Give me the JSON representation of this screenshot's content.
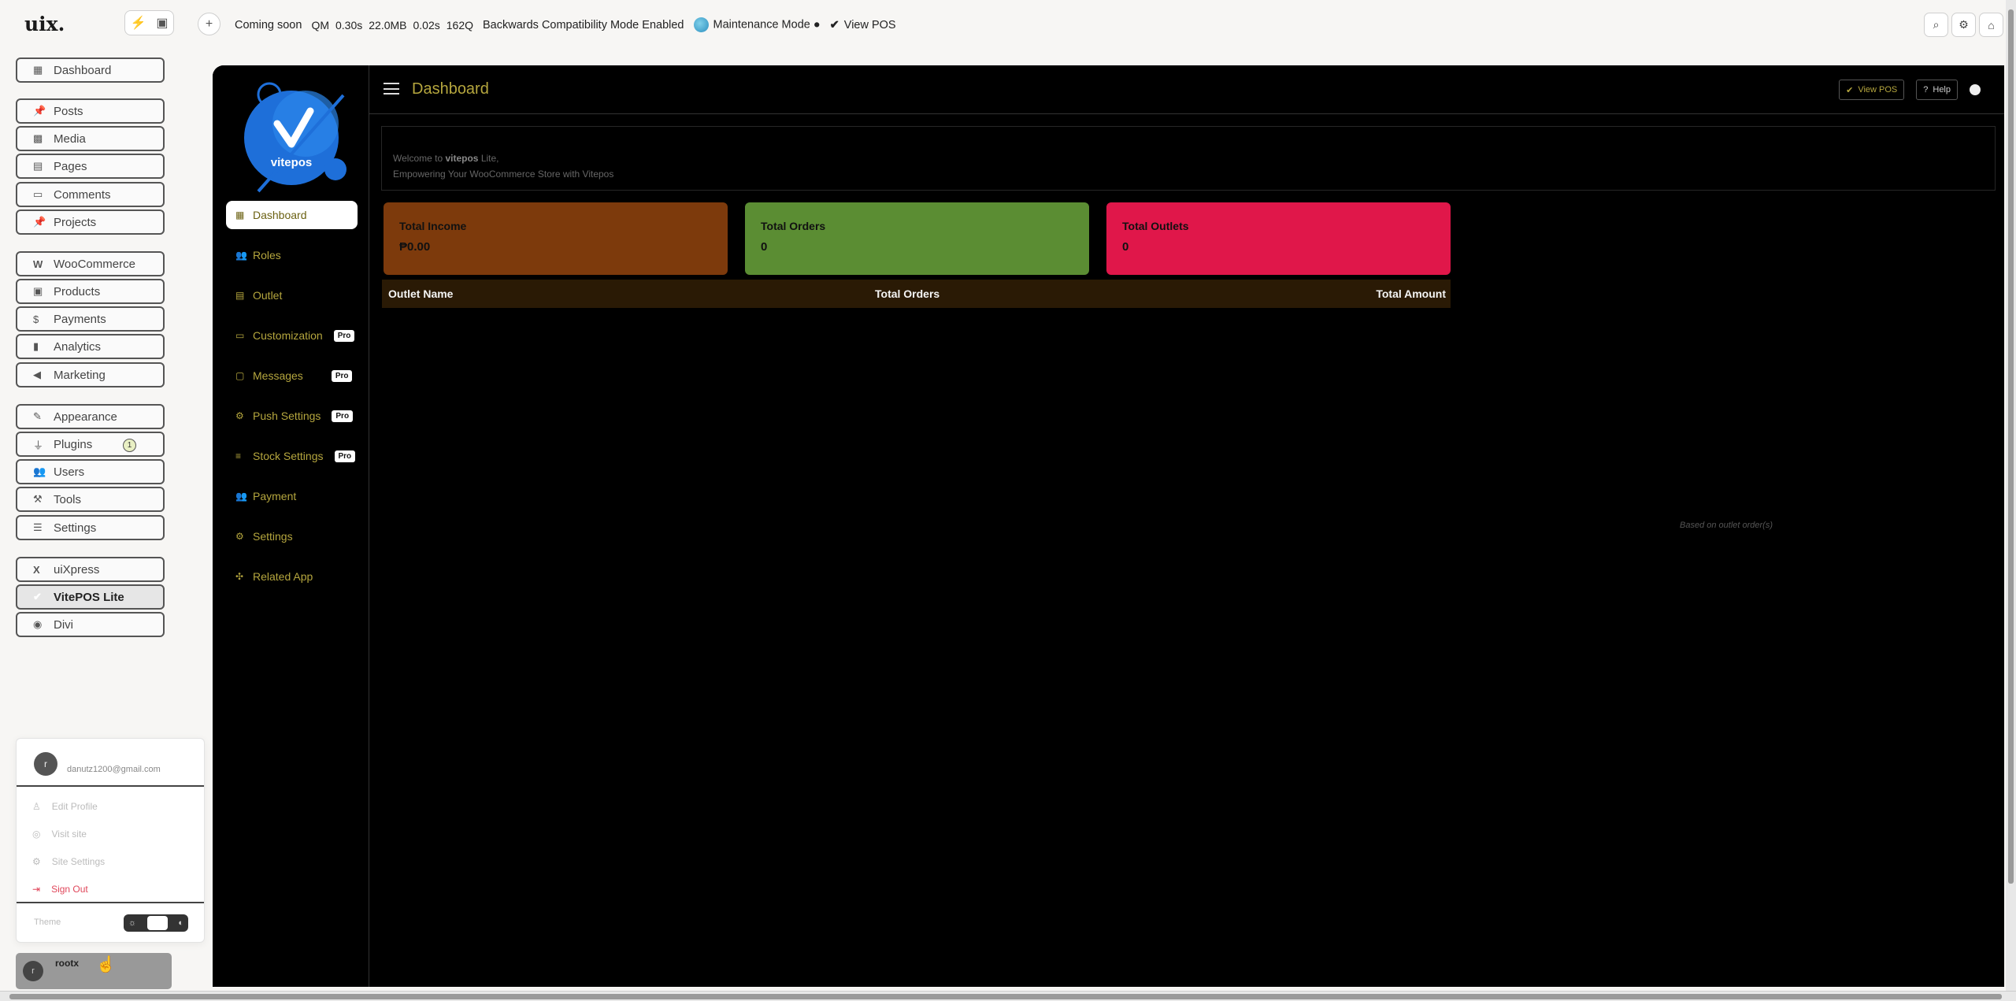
{
  "topbar": {
    "logo": "uix.",
    "items": [
      "Coming soon",
      "QM",
      "0.30s",
      "22.0MB",
      "0.02s",
      "162Q",
      "Backwards Compatibility Mode Enabled",
      "Maintenance Mode ●",
      "View POS"
    ]
  },
  "wp_menu": [
    {
      "label": "Dashboard",
      "icon": "grid-icon"
    },
    {
      "label": "Posts",
      "icon": "pin-icon"
    },
    {
      "label": "Media",
      "icon": "media-icon"
    },
    {
      "label": "Pages",
      "icon": "page-icon"
    },
    {
      "label": "Comments",
      "icon": "comment-icon"
    },
    {
      "label": "Projects",
      "icon": "pin-icon"
    },
    {
      "label": "WooCommerce",
      "icon": "woo-icon"
    },
    {
      "label": "Products",
      "icon": "box-icon"
    },
    {
      "label": "Payments",
      "icon": "dollar-icon"
    },
    {
      "label": "Analytics",
      "icon": "chart-icon"
    },
    {
      "label": "Marketing",
      "icon": "megaphone-icon"
    },
    {
      "label": "Appearance",
      "icon": "brush-icon"
    },
    {
      "label": "Plugins",
      "icon": "plug-icon",
      "badge": "1"
    },
    {
      "label": "Users",
      "icon": "users-icon"
    },
    {
      "label": "Tools",
      "icon": "wrench-icon"
    },
    {
      "label": "Settings",
      "icon": "sliders-icon"
    },
    {
      "label": "uiXpress",
      "icon": "x-icon"
    },
    {
      "label": "VitePOS Lite",
      "icon": "check-icon"
    },
    {
      "label": "Divi",
      "icon": "divi-icon"
    }
  ],
  "user_popup": {
    "avatar_letter": "r",
    "email": "danutz1200@gmail.com",
    "items": [
      "Edit Profile",
      "Visit site",
      "Site Settings",
      "Sign Out"
    ],
    "theme_label": "Theme"
  },
  "user_bar": {
    "avatar_letter": "r",
    "name": "rootx"
  },
  "vitepos": {
    "logo_text": "vitepos",
    "title": "Dashboard",
    "nav": [
      {
        "label": "Dashboard",
        "pro": false
      },
      {
        "label": "Roles",
        "pro": false
      },
      {
        "label": "Outlet",
        "pro": false
      },
      {
        "label": "Customization",
        "pro": true
      },
      {
        "label": "Messages",
        "pro": true
      },
      {
        "label": "Push Settings",
        "pro": true
      },
      {
        "label": "Stock Settings",
        "pro": true
      },
      {
        "label": "Payment",
        "pro": false
      },
      {
        "label": "Settings",
        "pro": false
      },
      {
        "label": "Related App",
        "pro": false
      }
    ],
    "pro_label": "Pro",
    "view_pos": "View POS",
    "help": "Help",
    "welcome_prefix": "Welcome to ",
    "welcome_brand": "vitepos",
    "welcome_suffix": " Lite,",
    "welcome_line2": "Empowering Your WooCommerce Store with Vitepos",
    "cards": [
      {
        "title": "Total Income",
        "value": "₱0.00",
        "color": "#7d3a0c"
      },
      {
        "title": "Total Orders",
        "value": "0",
        "color": "#5b8d33"
      },
      {
        "title": "Total Outlets",
        "value": "0",
        "color": "#e0174a"
      }
    ],
    "table_headers": [
      "Outlet Name",
      "Total Orders",
      "Total Amount"
    ],
    "note": "Based on outlet order(s)"
  }
}
